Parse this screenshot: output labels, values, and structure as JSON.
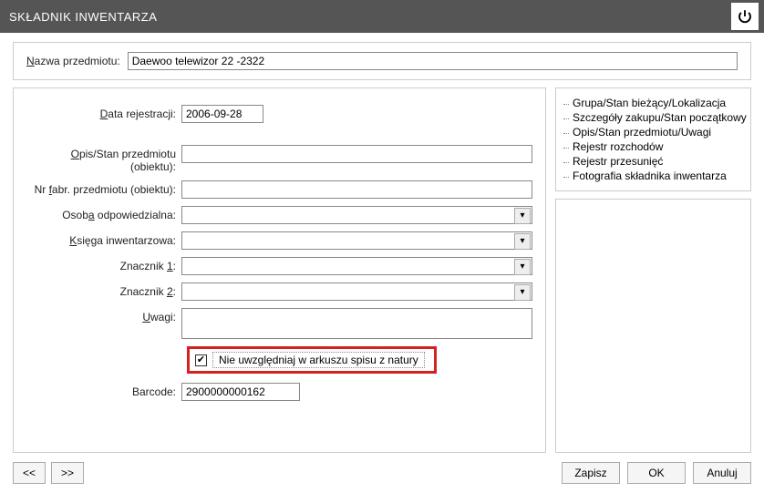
{
  "window": {
    "title": "SKŁADNIK INWENTARZA"
  },
  "header": {
    "name_label_pre": "N",
    "name_label_mid": "azwa przedmiotu:",
    "name_value": "Daewoo telewizor 22 -2322"
  },
  "form": {
    "date_label": "Data rejestracji:",
    "date_value": "2006-09-28",
    "desc_label_l1": "Opis/Stan przedmiotu",
    "desc_label_l2": "(obiektu):",
    "desc_value": "",
    "fabr_label_pre": "Nr ",
    "fabr_label_u": "f",
    "fabr_label_post": "abr. przedmiotu (obiektu):",
    "fabr_value": "",
    "osoba_label_pre": "Osob",
    "osoba_label_u": "a",
    "osoba_label_post": " odpowiedzialna:",
    "ksiega_label": "Księga inwentarzowa:",
    "zn1_label_pre": "Znacznik ",
    "zn1_label_u": "1",
    "zn1_label_post": ":",
    "zn2_label_pre": "Znacznik ",
    "zn2_label_u": "2",
    "zn2_label_post": ":",
    "uwagi_label": "Uwagi:",
    "uwagi_value": "",
    "checkbox_label": "Nie uwzględniaj w arkuszu spisu z natury",
    "checkbox_checked": "✔",
    "barcode_label": "Barcode:",
    "barcode_value": "2900000000162"
  },
  "tree": {
    "items": [
      "Grupa/Stan bieżący/Lokalizacja",
      "Szczegóły zakupu/Stan początkowy",
      "Opis/Stan przedmiotu/Uwagi",
      "Rejestr rozchodów",
      "Rejestr przesunięć",
      "Fotografia składnika inwentarza"
    ]
  },
  "buttons": {
    "prev": "<<",
    "next": ">>",
    "save": "Zapisz",
    "ok": "OK",
    "cancel": "Anuluj"
  }
}
